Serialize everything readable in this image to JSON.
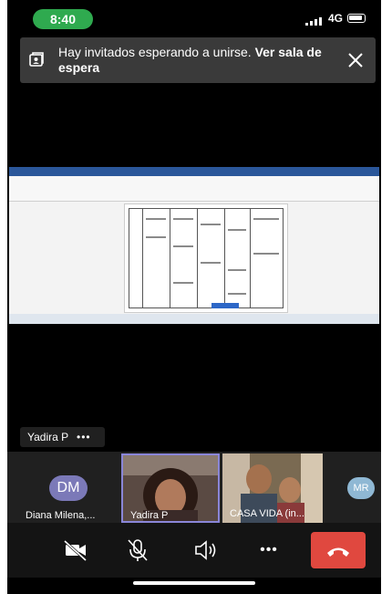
{
  "status_bar": {
    "time": "8:40",
    "network": "4G"
  },
  "banner": {
    "message": "Hay invitados esperando a unirse.",
    "link_label": "Ver sala de espera",
    "icon": "waiting-room-icon",
    "close_icon": "close-icon"
  },
  "stage": {
    "content": "shared-screen",
    "speaker_name": "Yadira P",
    "speaker_menu": "•••"
  },
  "participants": [
    {
      "initials": "DM",
      "name": "Diana Milena,...",
      "type": "avatar",
      "color": "#7b79b8"
    },
    {
      "name": "Yadira P",
      "type": "video",
      "active_speaker": true
    },
    {
      "name": "CASA VIDA (in...",
      "type": "video"
    },
    {
      "initials": "MR",
      "type": "avatar",
      "color": "#8fb8d4"
    }
  ],
  "controls": {
    "video": {
      "icon": "video-off-icon"
    },
    "mic": {
      "icon": "mic-off-icon"
    },
    "audio": {
      "icon": "speaker-icon"
    },
    "more": {
      "icon": "more-icon",
      "label": "•••"
    },
    "hangup": {
      "icon": "hang-up-icon",
      "color": "#e0483f"
    }
  },
  "colors": {
    "time_pill": "#2faa4f",
    "active_border": "#8a86d8",
    "hangup": "#e0483f"
  }
}
